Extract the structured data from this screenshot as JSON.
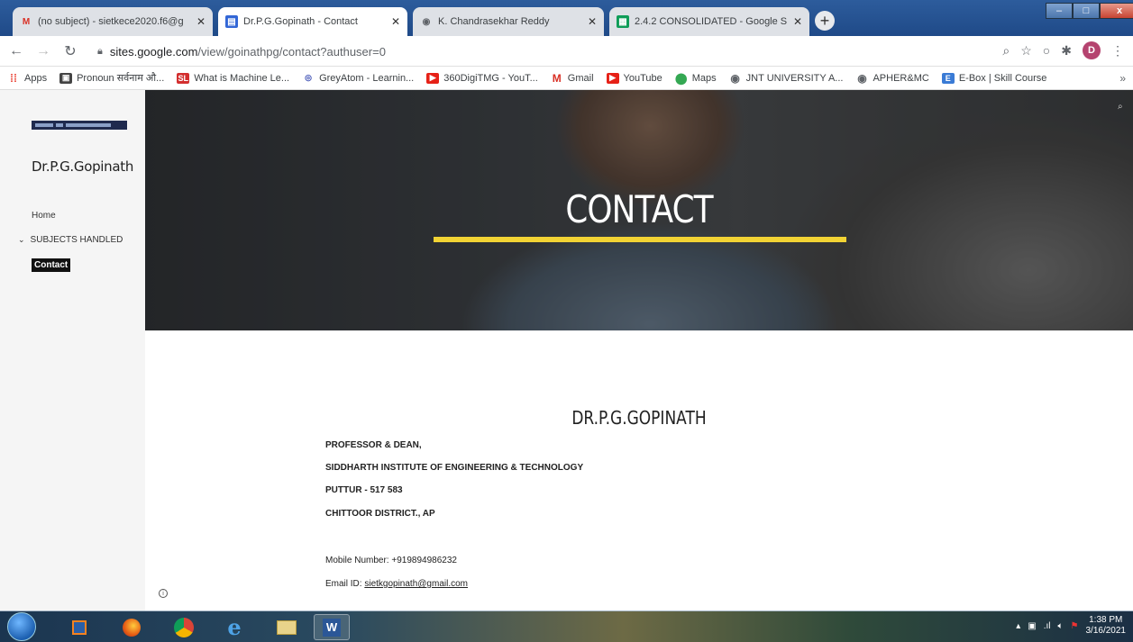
{
  "browser": {
    "tabs": [
      {
        "title": "(no subject) - sietkece2020.f6@g",
        "icon": "gmail-icon",
        "active": false
      },
      {
        "title": "Dr.P.G.Gopinath - Contact",
        "icon": "google-sites-icon",
        "active": true
      },
      {
        "title": "K. Chandrasekhar Reddy",
        "icon": "globe-icon",
        "active": false
      },
      {
        "title": "2.4.2 CONSOLIDATED - Google S",
        "icon": "google-sheets-icon",
        "active": false
      }
    ],
    "new_tab": "+",
    "window_controls": {
      "minimize": "–",
      "maximize": "□",
      "close": "x"
    },
    "address": {
      "host": "sites.google.com",
      "path": "/view/goinathpg/contact?authuser=0"
    },
    "profile_initial": "D",
    "bookmarks": [
      {
        "label": "Apps",
        "icon": "apps-grid-icon"
      },
      {
        "label": "Pronoun सर्वनाम औ...",
        "icon": "bookmark-icon"
      },
      {
        "label": "What is Machine Le...",
        "icon": "sl-icon"
      },
      {
        "label": "GreyAtom - Learnin...",
        "icon": "greyatom-icon"
      },
      {
        "label": "360DigiTMG - YouT...",
        "icon": "youtube-icon"
      },
      {
        "label": "Gmail",
        "icon": "gmail-icon"
      },
      {
        "label": "YouTube",
        "icon": "youtube-icon"
      },
      {
        "label": "Maps",
        "icon": "maps-icon"
      },
      {
        "label": "JNT UNIVERSITY A...",
        "icon": "globe-icon"
      },
      {
        "label": "APHER&MC",
        "icon": "globe-icon"
      },
      {
        "label": "E-Box | Skill Course",
        "icon": "ebox-icon"
      }
    ],
    "bookmarks_more": "»"
  },
  "site": {
    "title": "Dr.P.G.Gopinath",
    "nav": {
      "home": "Home",
      "subjects": "SUBJECTS HANDLED",
      "contact": "Contact"
    },
    "hero_title": "CONTACT",
    "contact": {
      "name": "DR.P.G.GOPINATH",
      "lines": [
        "PROFESSOR & DEAN,",
        "SIDDHARTH INSTITUTE OF ENGINEERING & TECHNOLOGY",
        "PUTTUR - 517 583",
        "CHITTOOR DISTRICT., AP"
      ],
      "mobile_label": "Mobile Number: +919894986232",
      "email_label": "Email ID: ",
      "email": "sietkgopinath@gmail.com"
    },
    "accent_color": "#f2d334"
  },
  "taskbar": {
    "time": "1:38 PM",
    "date": "3/16/2021"
  }
}
